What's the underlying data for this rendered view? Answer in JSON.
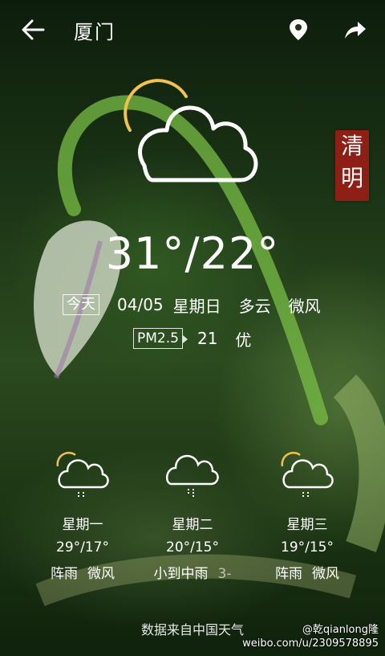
{
  "header": {
    "city": "厦门"
  },
  "solar_term": {
    "line1": "清",
    "line2": "明"
  },
  "current": {
    "temperature": "31°/22°",
    "today_label": "今天",
    "date": "04/05",
    "weekday": "星期日",
    "condition": "多云",
    "wind": "微风",
    "aqi_label": "PM2.5",
    "aqi_value": "21",
    "aqi_quality": "优"
  },
  "forecast": [
    {
      "day": "星期一",
      "temp": "29°/17°",
      "cond1": "阵雨",
      "cond2": "微风",
      "icon": "sun-cloud-rain-icon"
    },
    {
      "day": "星期二",
      "temp": "20°/15°",
      "cond1": "小到中雨",
      "cond2": "3-",
      "icon": "cloud-rain-icon"
    },
    {
      "day": "星期三",
      "temp": "19°/15°",
      "cond1": "阵雨",
      "cond2": "微风",
      "icon": "sun-cloud-rain-icon"
    }
  ],
  "footer": {
    "source": "数据来自中国天气"
  },
  "watermark": {
    "line1": "@乾qianlong隆",
    "line2": "weibo.com/u/2309578895"
  },
  "colors": {
    "sun_arc": "#f2c14e",
    "seal_red": "#8e1f17"
  }
}
